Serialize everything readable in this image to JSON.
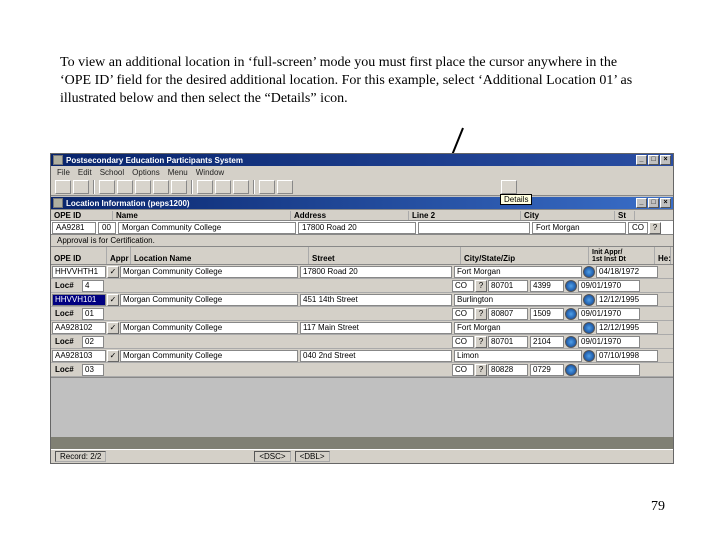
{
  "instruction_text": "To view an additional location in ‘full-screen’ mode you must first place the cursor anywhere in the ‘OPE ID’ field for the desired additional location.  For this example, select ‘Additional Location 01’ as illustrated below and then select the “Details” icon.",
  "page_number": "79",
  "app_title": "Postsecondary Education Participants System",
  "doc_title": "Location Information (peps1200)",
  "menu": [
    "File",
    "Edit",
    "School",
    "Options",
    "Menu",
    "Window"
  ],
  "tooltip_details": "Details",
  "top_grid": {
    "headers": {
      "ope": "OPE ID",
      "name": "Name",
      "address": "Address",
      "line2": "Line 2",
      "city": "City",
      "st": "St"
    },
    "row": {
      "ope": "AA9281",
      "br": "00",
      "name": "Morgan Community College",
      "address": "17800 Road 20",
      "line2": "",
      "city": "Fort Morgan",
      "st": "CO"
    }
  },
  "banner": "Approval is for Certification.",
  "sub_headers": {
    "ope": "OPE ID",
    "appr": "Appr",
    "locname": "Location Name",
    "street": "Street",
    "csz": "City/State/Zip",
    "date": "Init Appr/\n1st Inst Dt",
    "he": "He:"
  },
  "loc_label": "Loc#",
  "rows": [
    {
      "ope": "HHVVHTH1",
      "loc": "4",
      "appr": true,
      "name": "Morgan Community College",
      "street": "17800 Road 20",
      "city": "Fort Morgan",
      "st": "CO",
      "zip1": "80701",
      "zip2": "4399",
      "date": "04/18/1972",
      "date2": "09/01/1970"
    },
    {
      "ope": "HHVVH101",
      "loc": "01",
      "appr": true,
      "name": "Morgan Community College",
      "street": "451 14th Street",
      "city": "Burlington",
      "st": "CO",
      "zip1": "80807",
      "zip2": "1509",
      "date": "12/12/1995",
      "date2": "09/01/1970"
    },
    {
      "ope": "AA928102",
      "loc": "02",
      "appr": true,
      "name": "Morgan Community College",
      "street": "117 Main Street",
      "city": "Fort Morgan",
      "st": "CO",
      "zip1": "80701",
      "zip2": "2104",
      "date": "12/12/1995",
      "date2": "09/01/1970"
    },
    {
      "ope": "AA928103",
      "loc": "03",
      "appr": true,
      "name": "Morgan Community College",
      "street": "040 2nd Street",
      "city": "Limon",
      "st": "CO",
      "zip1": "80828",
      "zip2": "0729",
      "date": "07/10/1998",
      "date2": ""
    }
  ],
  "highlight_row_index": 1,
  "status": {
    "record": "Record: 2/2",
    "mode1": "<DSC>",
    "mode2": "<DBL>"
  }
}
